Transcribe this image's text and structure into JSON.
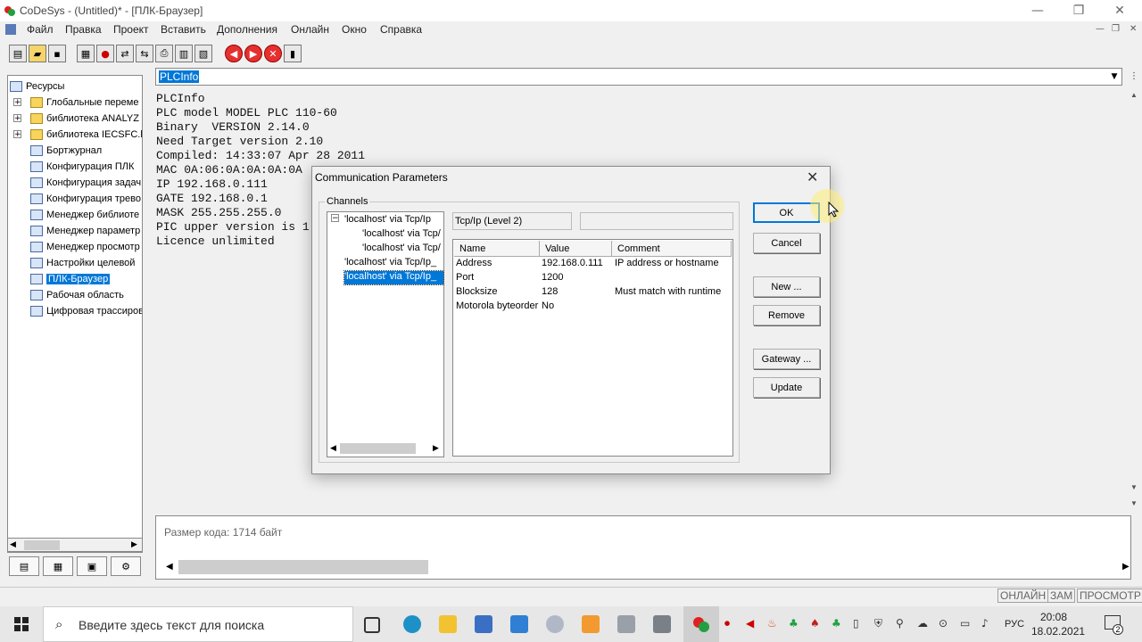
{
  "window": {
    "title": "CoDeSys - (Untitled)* - [ПЛК-Браузер]",
    "min_glyph": "—",
    "restore_glyph": "❐",
    "close_glyph": "✕"
  },
  "menu": [
    "Файл",
    "Правка",
    "Проект",
    "Вставить",
    "Дополнения",
    "Онлайн",
    "Окно",
    "Справка"
  ],
  "mdi_controls": [
    "—",
    "❐",
    "✕"
  ],
  "toolbar": {
    "buttons": [
      "new",
      "open",
      "save",
      "build",
      "stop",
      "login",
      "logout",
      "print",
      "run",
      "step",
      "breakpoint-prev",
      "breakpoint-next",
      "stop-red",
      "cycle"
    ]
  },
  "resources": {
    "root": "Ресурсы",
    "items": [
      {
        "label": "Глобальные переме",
        "type": "folder",
        "expandable": true
      },
      {
        "label": "библиотека ANALYZ",
        "type": "folder",
        "expandable": true
      },
      {
        "label": "библиотека IECSFC.l",
        "type": "folder",
        "expandable": true
      },
      {
        "label": "Бортжурнал",
        "type": "object"
      },
      {
        "label": "Конфигурация ПЛК",
        "type": "object"
      },
      {
        "label": "Конфигурация задач",
        "type": "object"
      },
      {
        "label": "Конфигурация трево",
        "type": "object"
      },
      {
        "label": "Менеджер библиоте",
        "type": "object"
      },
      {
        "label": "Менеджер параметр",
        "type": "object"
      },
      {
        "label": "Менеджер просмотр",
        "type": "object"
      },
      {
        "label": "Настройки целевой",
        "type": "object"
      },
      {
        "label": "ПЛК-Браузер",
        "type": "object",
        "selected": true
      },
      {
        "label": "Рабочая область",
        "type": "object"
      },
      {
        "label": "Цифровая трассиров",
        "type": "object"
      }
    ]
  },
  "plc_browser": {
    "command": "PLCInfo",
    "output": [
      "PLCInfo",
      "PLC model MODEL PLC 110-60",
      "Binary  VERSION 2.14.0",
      "Need Target version 2.10",
      "Compiled: 14:33:07 Apr 28 2011",
      "MAC 0A:06:0A:0A:0A:0A",
      "IP 192.168.0.111",
      "GATE 192.168.0.1",
      "MASK 255.255.255.0",
      "PIC upper version is 1",
      "Licence unlimited"
    ]
  },
  "messages": {
    "text": "Размер кода: 1714 байт"
  },
  "status": {
    "online": "ОНЛАЙН",
    "caps": "ЗАМ",
    "mode": "ПРОСМОТР"
  },
  "dialog": {
    "title": "Communication Parameters",
    "channels_label": "Channels",
    "channels": [
      {
        "label": "'localhost' via Tcp/Ip",
        "level": 0,
        "expandable": true
      },
      {
        "label": "'localhost' via Tcp/",
        "level": 1
      },
      {
        "label": "'localhost' via Tcp/",
        "level": 1
      },
      {
        "label": "'localhost' via Tcp/Ip_",
        "level": 0
      },
      {
        "label": "'localhost' via Tcp/Ip_",
        "level": 0,
        "selected": true
      }
    ],
    "driver_label": "Tcp/Ip (Level 2)",
    "driver_extra": "",
    "columns": [
      "Name",
      "Value",
      "Comment"
    ],
    "params": [
      {
        "name": "Address",
        "value": "192.168.0.111",
        "comment": "IP address or hostname"
      },
      {
        "name": "Port",
        "value": "1200",
        "comment": ""
      },
      {
        "name": "Blocksize",
        "value": "128",
        "comment": "Must match with runtime"
      },
      {
        "name": "Motorola byteorder",
        "value": "No",
        "comment": ""
      }
    ],
    "buttons": {
      "ok": "OK",
      "cancel": "Cancel",
      "new": "New ...",
      "remove": "Remove",
      "gateway": "Gateway ...",
      "update": "Update"
    }
  },
  "taskbar": {
    "search_placeholder": "Введите здесь текст для поиска",
    "language": "РУС",
    "time": "20:08",
    "date": "18.02.2021",
    "notifications": "2"
  }
}
